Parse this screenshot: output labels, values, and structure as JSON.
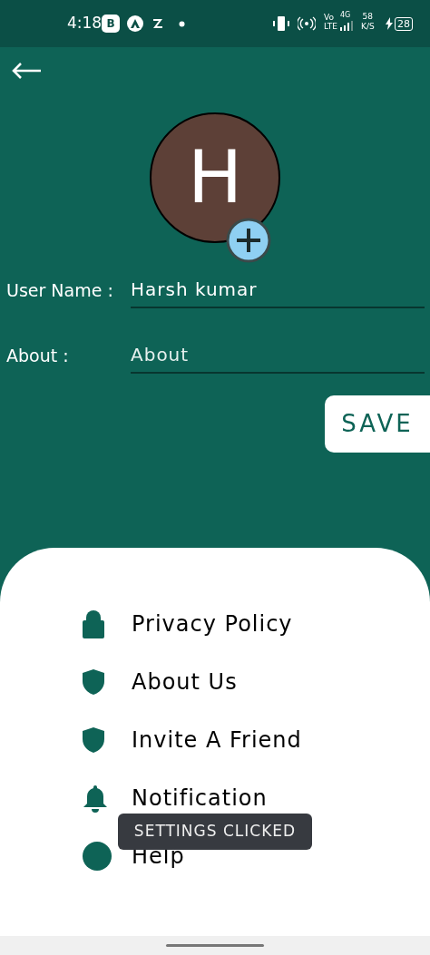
{
  "status_bar": {
    "time": "4:18",
    "app_badge": "B",
    "network_top": "4G",
    "network_volte": "Vo",
    "network_lte": "LTE",
    "speed": "58",
    "speed_unit": "K/S",
    "battery": "28"
  },
  "avatar": {
    "letter": "H"
  },
  "fields": [
    {
      "label": "User Name :",
      "value": "Harsh kumar",
      "kind": "value"
    },
    {
      "label": "About :",
      "placeholder": "About",
      "kind": "placeholder"
    }
  ],
  "save_button": "SAVE",
  "menu": [
    {
      "label": "Privacy Policy",
      "kind": "lock"
    },
    {
      "label": "About Us",
      "kind": "shield"
    },
    {
      "label": "Invite A Friend",
      "kind": "shield"
    },
    {
      "label": "Notification",
      "kind": "bell"
    },
    {
      "label": "Help",
      "kind": "circle"
    }
  ],
  "toast": "SETTINGS CLICKED"
}
